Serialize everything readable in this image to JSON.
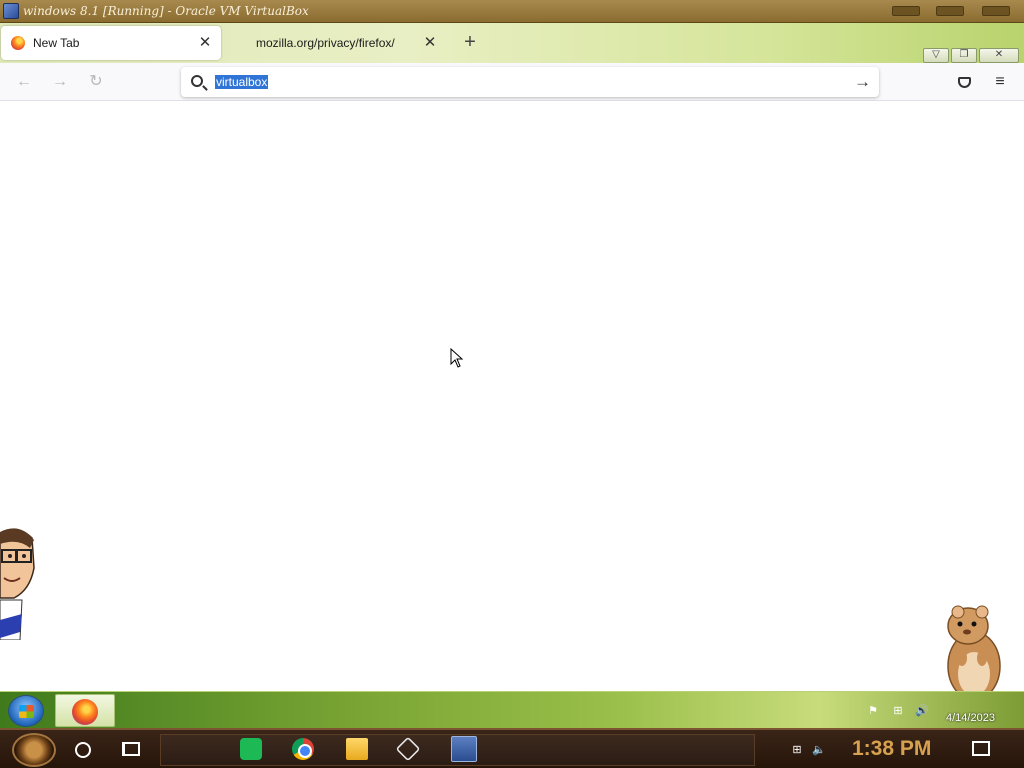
{
  "vbox": {
    "title": "windows 8.1 [Running] - Oracle VM VirtualBox"
  },
  "browser": {
    "tabs": [
      {
        "label": "New Tab",
        "active": true
      },
      {
        "label": "mozilla.org/privacy/firefox/",
        "active": false
      }
    ],
    "close_glyph": "✕",
    "new_tab_glyph": "+",
    "window_controls": [
      "▽",
      "❐",
      "✕"
    ],
    "nav": {
      "back": "←",
      "forward": "→",
      "reload": "↻"
    },
    "urlbar": {
      "value": "virtualbox",
      "go_glyph": "→"
    },
    "menu_glyph": "≡"
  },
  "guest_taskbar": {
    "date": "4/14/2023",
    "tray": [
      "⚑",
      "⊞",
      "🔊"
    ]
  },
  "host_taskbar": {
    "clock": "1:38 PM",
    "tray": [
      "⊞",
      "🔈"
    ]
  },
  "colors": {
    "url_selection": "#3074d6",
    "clock": "#d7a24f",
    "guest_taskbar_green": "#7aa534"
  }
}
